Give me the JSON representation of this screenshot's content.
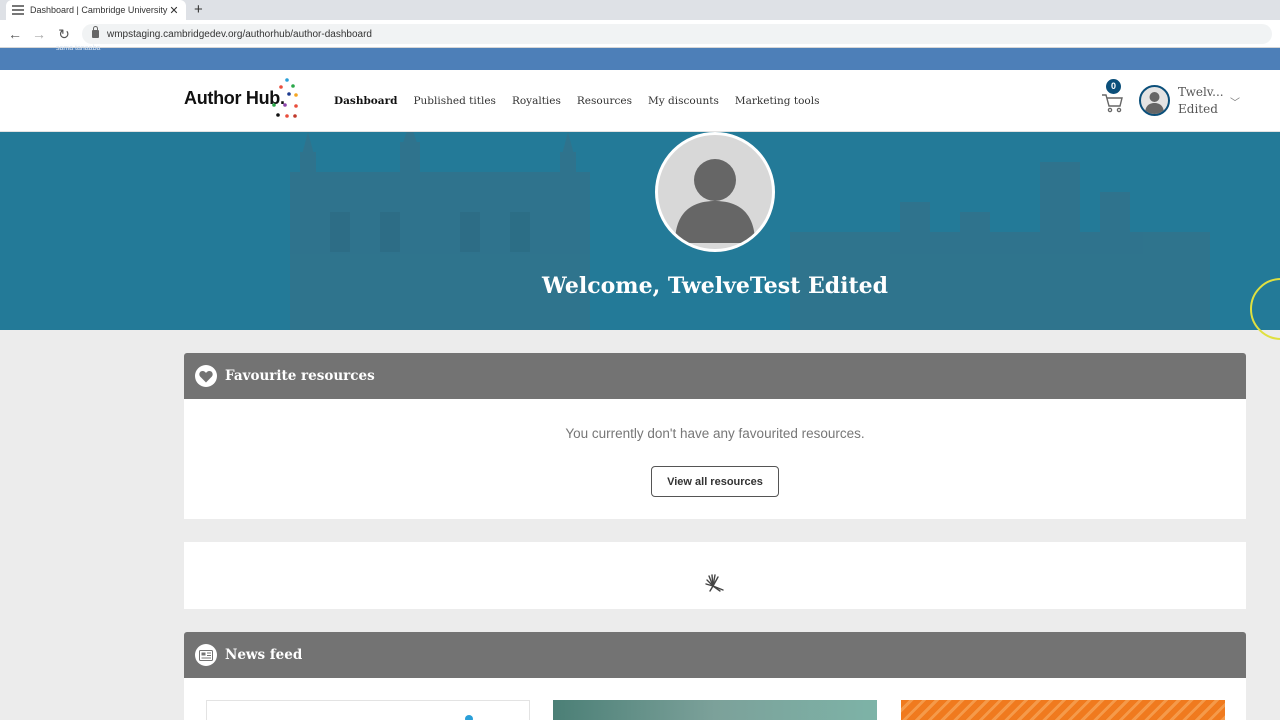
{
  "browser": {
    "tab_title": "Dashboard | Cambridge University",
    "tab_close": "✕",
    "new_tab": "+",
    "url": "wmpstaging.cambridgedev.org/authorhub/author-dashboard"
  },
  "strip": {
    "text": "sama tanaaba"
  },
  "header": {
    "logo": "Author Hub.",
    "nav": [
      "Dashboard",
      "Published titles",
      "Royalties",
      "Resources",
      "My discounts",
      "Marketing tools"
    ],
    "cart_count": "0",
    "user_name_line1": "Twelv...",
    "user_name_line2": "Edited"
  },
  "hero": {
    "welcome": "Welcome, TwelveTest Edited"
  },
  "favourites": {
    "title": "Favourite resources",
    "empty_message": "You currently don't have any favourited resources.",
    "button": "View all resources"
  },
  "news": {
    "title": "News feed"
  },
  "colors": {
    "header_blue": "#4d7fb8",
    "hero_teal": "#237a98",
    "card_header_grey": "#737373",
    "badge_navy": "#0b4f7a"
  }
}
